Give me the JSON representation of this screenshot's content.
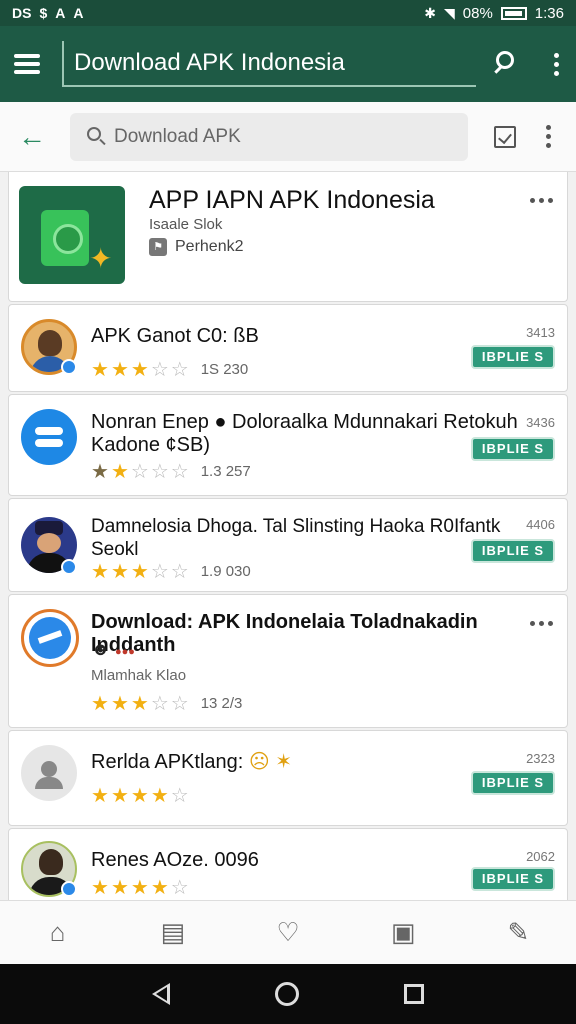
{
  "status_bar": {
    "left_icons": [
      "DS",
      "$",
      "A",
      "A"
    ],
    "battery": "08%",
    "time": "1:36"
  },
  "app_bar": {
    "title": "Download APK Indonesia"
  },
  "search": {
    "placeholder": "Download APK"
  },
  "featured": {
    "title": "APP IAPN APK Indonesia",
    "subtitle": "Isaale Slok",
    "meta": "Perhenk2"
  },
  "apps": [
    {
      "title": "APK Ganot C0: ßB",
      "stars": 3,
      "count": "1S 230",
      "size": "3413",
      "button": "IBPLIE S"
    },
    {
      "title": "Nonran Enep ● Doloraalka Mdunnakari Retokuh Kadone ¢SB)",
      "stars": 2,
      "count": "1.3 257",
      "size": "3436",
      "button": "IBPLIE S"
    },
    {
      "title": "Damnelosia Dhoga. Tal Slinsting Haoka R0Ifantk Seokl",
      "stars": 3,
      "count": "1.9 030",
      "size": "4406",
      "button": "IBPLIE S"
    },
    {
      "title": "Download: APK Indonelaia Toladnakadin Inddanth",
      "subtitle": "Mlamhak Klao",
      "stars": 3,
      "count": "13 2/3"
    },
    {
      "title": "Rerlda APKtlang:",
      "stars": 4,
      "count": "",
      "size": "2323",
      "button": "IBPLIE S"
    },
    {
      "title": "Renes AOze. 0096",
      "stars": 4,
      "count": "",
      "size": "2062",
      "button": "IBPLIE S"
    }
  ],
  "colors": {
    "status_bar": "#1b4d3a",
    "app_bar": "#1e5a45",
    "accent": "#2e9a7c",
    "star": "#f2b012"
  },
  "bottom_nav": [
    "home-icon",
    "message-icon",
    "heart-icon",
    "inbox-icon",
    "edit-icon"
  ],
  "system_nav": [
    "back",
    "home",
    "recents"
  ]
}
